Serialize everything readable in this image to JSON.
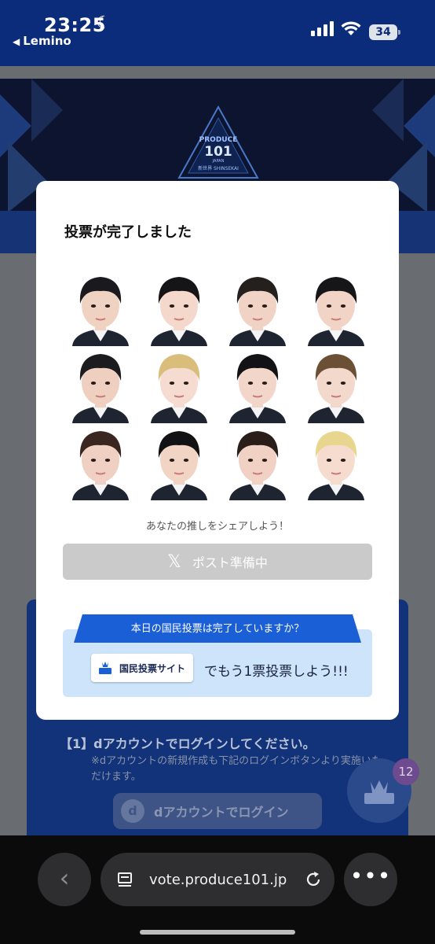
{
  "status": {
    "time": "23:25",
    "back_app": "Lemino",
    "battery": "34"
  },
  "hero": {
    "logo_lines": [
      "PRODUCE",
      "101",
      "JAPAN",
      "新世界 SHINSEKAI"
    ]
  },
  "background": {
    "login_step": "【1】dアカウントでログインしてください。",
    "login_note": "※dアカウントの新規作成も下記のログインボタンより実施いただけます。",
    "login_button": "dアカウントでログイン",
    "badge_count": "12"
  },
  "modal": {
    "title": "投票が完了しました",
    "share_text": "あなたの推しをシェアしよう！",
    "post_button": "ポスト準備中",
    "banner_text": "本日の国民投票は完了していますか？",
    "site_button": "国民投票サイト",
    "vote_again": "でもう1票投票しよう!!!",
    "faces": [
      {
        "hair": "#1a1a1e",
        "skin": "#f0d2c2"
      },
      {
        "hair": "#151518",
        "skin": "#f4d8cc"
      },
      {
        "hair": "#24201e",
        "skin": "#f1d3c5"
      },
      {
        "hair": "#161618",
        "skin": "#f2d4c6"
      },
      {
        "hair": "#1b1b20",
        "skin": "#efd0c0"
      },
      {
        "hair": "#d8be7a",
        "skin": "#f5dbd0"
      },
      {
        "hair": "#131316",
        "skin": "#f3d6ca"
      },
      {
        "hair": "#6b5036",
        "skin": "#f3d8cc"
      },
      {
        "hair": "#3a2620",
        "skin": "#efd0c2"
      },
      {
        "hair": "#121214",
        "skin": "#f2d4c4"
      },
      {
        "hair": "#2a1e1a",
        "skin": "#f0d1c3"
      },
      {
        "hair": "#e8d68e",
        "skin": "#f6dbcf"
      }
    ]
  },
  "browser": {
    "url": "vote.produce101.jp"
  },
  "colors": {
    "statusbar": "#0a2c7a",
    "banner": "#1a5fd6",
    "vote_box": "#cde4fb",
    "post_button": "#cacaca"
  }
}
